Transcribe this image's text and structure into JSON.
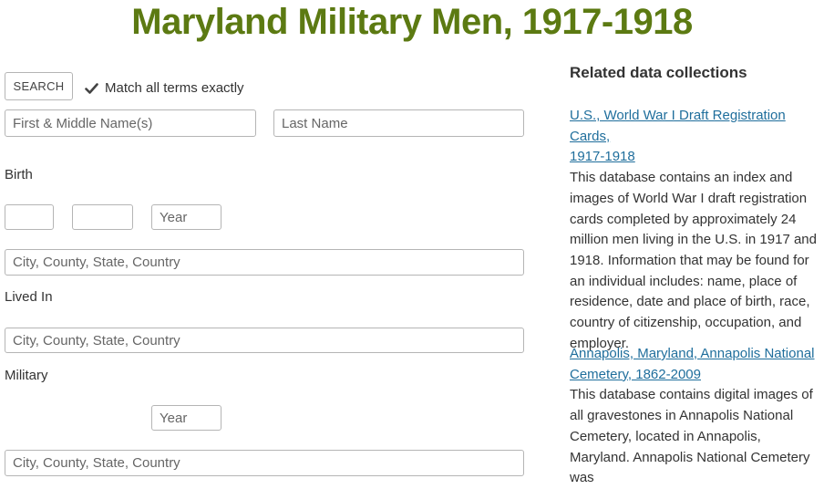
{
  "page": {
    "title": "Maryland Military Men, 1917-1918"
  },
  "search": {
    "button_label": "SEARCH",
    "match_exact_label": "Match all terms exactly",
    "first_name_placeholder": "First & Middle Name(s)",
    "last_name_placeholder": "Last Name"
  },
  "birth": {
    "label": "Birth",
    "year_placeholder": "Year",
    "place_placeholder": "City, County, State, Country"
  },
  "lived_in": {
    "label": "Lived In",
    "place_placeholder": "City, County, State, Country"
  },
  "military": {
    "label": "Military",
    "year_placeholder": "Year",
    "place_placeholder": "City, County, State, Country"
  },
  "related": {
    "heading": "Related data collections",
    "items": [
      {
        "link_line1": "U.S., World War I Draft Registration Cards,",
        "link_line2": "1917-1918",
        "description": "This database contains an index and images of World War I draft registration cards completed by approximately 24 million men living in the U.S. in 1917 and 1918. Information that may be found for an individual includes: name, place of residence, date and place of birth, race, country of citizenship, occupation, and employer."
      },
      {
        "link_line1": "Annapolis, Maryland, Annapolis National",
        "link_line2": "Cemetery, 1862-2009",
        "description": "This database contains digital images of all gravestones in Annapolis National Cemetery, located in Annapolis, Maryland. Annapolis National Cemetery was"
      }
    ]
  }
}
